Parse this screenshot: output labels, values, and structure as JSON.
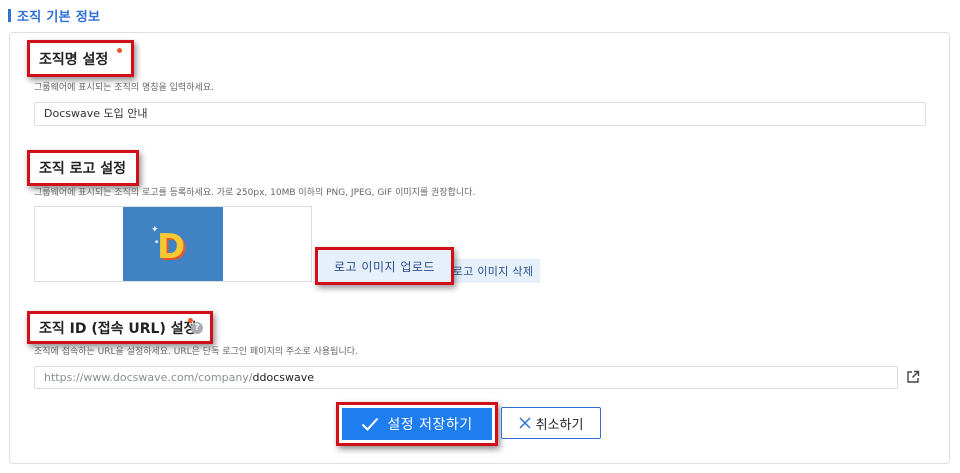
{
  "section": {
    "title": "조직 기본 정보"
  },
  "name_setting": {
    "label": "조직명 설정",
    "description": "그룹웨어에 표시되는 조직의 명칭을 입력하세요.",
    "value": "Docswave 도입 안내"
  },
  "logo_setting": {
    "label": "조직 로고 설정",
    "description": "그룹웨어에 표시되는 조직의 로고를 등록하세요. 가로 250px, 10MB 이하의 PNG, JPEG, GIF 이미지를 권장합니다.",
    "logo_letter": "D",
    "upload_label": "로고 이미지 업로드",
    "delete_label": "로고 이미지 삭제"
  },
  "id_setting": {
    "label": "조직 ID (접속 URL) 설정",
    "description": "조직에 접속하는 URL을 설정하세요. URL은 단독 로그인 페이지의 주소로 사용됩니다.",
    "url_prefix": "https://www.docswave.com/company/",
    "url_value": "ddocswave",
    "help_icon": "question-circle-icon",
    "link_icon": "external-link-icon"
  },
  "actions": {
    "save_label": "설정 저장하기",
    "cancel_label": "취소하기"
  },
  "colors": {
    "accent": "#1e7ef0",
    "highlight_border": "#d10f18",
    "required_dot": "#ea5a2a"
  }
}
